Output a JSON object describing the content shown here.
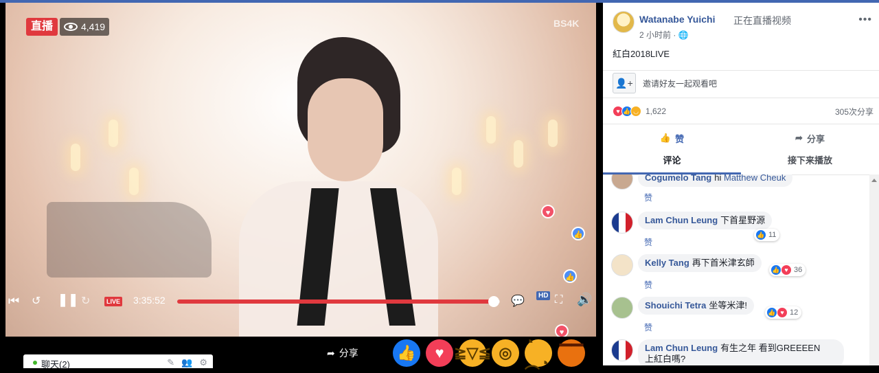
{
  "video": {
    "live_badge": "直播",
    "viewer_count": "4,419",
    "watermark": "BS4K",
    "live_chip": "LIVE",
    "elapsed_time": "3:35:52",
    "progress_fraction": 0.98,
    "hd_label": "HD"
  },
  "bottom_bar": {
    "chat_label": "聊天(2)",
    "share_label": "分享",
    "reactions": [
      "like",
      "love",
      "haha",
      "wow",
      "sad",
      "angry"
    ]
  },
  "post": {
    "poster_name": "Watanabe Yuichi",
    "poster_action": "正在直播视频",
    "time_ago": "2 小时前",
    "text": "紅白2018LIVE",
    "invite_text": "邀请好友一起观看吧",
    "reaction_count": "1,622",
    "share_count": "305次分享",
    "like_label": "赞",
    "share_label": "分享"
  },
  "tabs": {
    "comments": "评论",
    "up_next": "接下来播放"
  },
  "comments": [
    {
      "name": "Cogumelo Tang",
      "text": "hi ",
      "mention": "Matthew Cheuk",
      "like_label": "赞",
      "count": ""
    },
    {
      "name": "Lam Chun Leung",
      "text": "下首星野源",
      "mention": "",
      "like_label": "赞",
      "count": "11"
    },
    {
      "name": "Kelly Tang",
      "text": "再下首米津玄師",
      "mention": "",
      "like_label": "赞",
      "count": "36"
    },
    {
      "name": "Shouichi Tetra",
      "text": "坐等米津!",
      "mention": "",
      "like_label": "赞",
      "count": "12"
    },
    {
      "name": "Lam Chun Leung",
      "text": "有生之年 看到GREEEEN",
      "text2": "上紅白嗎?",
      "mention": "",
      "like_label": "",
      "count": ""
    }
  ],
  "colors": {
    "brand": "#4267b2",
    "live_red": "#e0393e",
    "link": "#365899"
  }
}
